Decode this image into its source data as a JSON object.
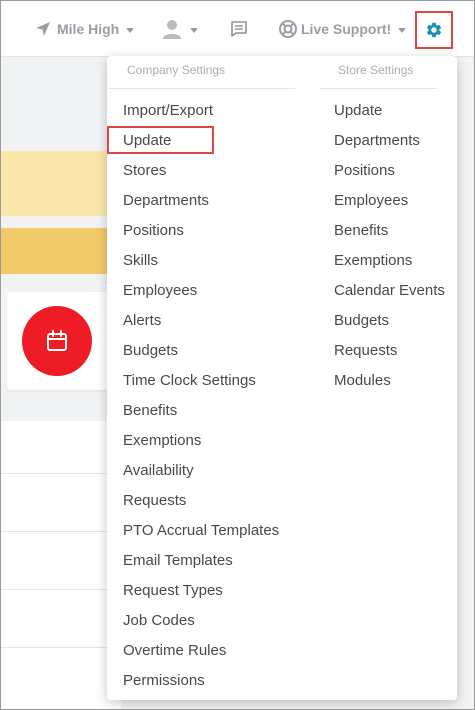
{
  "topbar": {
    "location_label": "Mile High",
    "support_label": "Live Support!"
  },
  "menu": {
    "company_heading": "Company Settings",
    "store_heading": "Store Settings",
    "company_items": [
      "Import/Export",
      "Update",
      "Stores",
      "Departments",
      "Positions",
      "Skills",
      "Employees",
      "Alerts",
      "Budgets",
      "Time Clock Settings",
      "Benefits",
      "Exemptions",
      "Availability",
      "Requests",
      "PTO Accrual Templates",
      "Email Templates",
      "Request Types",
      "Job Codes",
      "Overtime Rules",
      "Permissions"
    ],
    "store_items": [
      "Update",
      "Departments",
      "Positions",
      "Employees",
      "Benefits",
      "Exemptions",
      "Calendar Events",
      "Budgets",
      "Requests",
      "Modules"
    ]
  },
  "colors": {
    "accent": "#1a8fb0",
    "highlight": "#e04545",
    "calendar": "#ee1c25"
  },
  "icons": [
    "location-arrow-icon",
    "user-avatar-icon",
    "chat-icon",
    "lifebuoy-icon",
    "gear-icon",
    "calendar-icon"
  ]
}
